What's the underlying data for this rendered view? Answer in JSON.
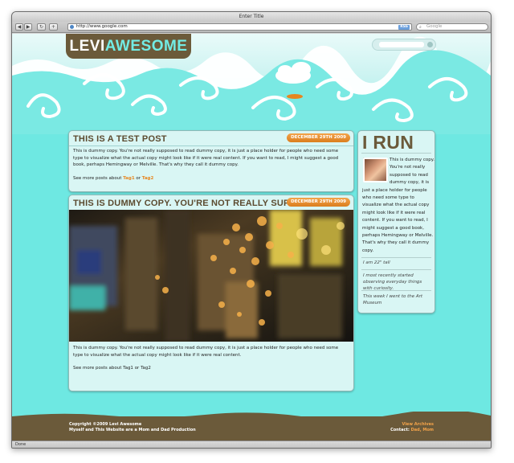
{
  "browser": {
    "window_title": "Enter Title",
    "url": "http://www.google.com",
    "rss_label": "RSS",
    "search_placeholder": "Google",
    "status": "Done"
  },
  "site": {
    "logo_part1": "LEVI",
    "logo_part2": "AWESOME",
    "colors": {
      "brand_brown": "#6b5a3a",
      "accent_aqua": "#6ee8e2",
      "accent_orange": "#e7861f"
    }
  },
  "posts": [
    {
      "title": "THIS IS A TEST POST",
      "date": "DECEMBER 29TH 2009",
      "body": "This is dummy copy. You're not really supposed to read dummy copy, it is just a place holder for people who need some type to visualize what the actual copy might look like if it were real content. If you want to read, I might suggest a good book, perhaps Hemingway or Melville. That's why they call it dummy copy.",
      "tags_prefix": "See more posts about",
      "tag1": "Tag1",
      "tag_separator": "or",
      "tag2": "Tag2"
    },
    {
      "title": "THIS IS DUMMY COPY. YOU'RE NOT REALLY SUPPOSED",
      "date": "DECEMBER 29TH 2009",
      "body": "This is dummy copy. You're not really supposed to read dummy copy, it is just a place holder for people who need some type to visualize what the actual copy might look like if it were real content.",
      "tags_prefix": "See more posts about",
      "tag1": "Tag1",
      "tag_separator": "or",
      "tag2": "Tag2"
    }
  ],
  "sidebar": {
    "title": "I RUN IT",
    "about": "This is dummy copy. You're not really supposed to read dummy copy, it is just a place holder for people who need some type to visualize what the actual copy might look like if it were real content. If you want to read, I might suggest a good book, perhaps Hemingway or Melville. That's why they call it dummy copy.",
    "facts": [
      "I am 22\" tall",
      "I most recently started observing everyday things with curiosity.",
      "This week I went to the Art Museum"
    ]
  },
  "footer": {
    "copyright": "Copyright ©2009 Levi Awesome",
    "credit": "Myself and This Website are a Mom and Dad Production",
    "archives_link": "View Archives",
    "contact_label": "Contact:",
    "contact_dad": "Dad",
    "contact_mom": "Mom"
  }
}
